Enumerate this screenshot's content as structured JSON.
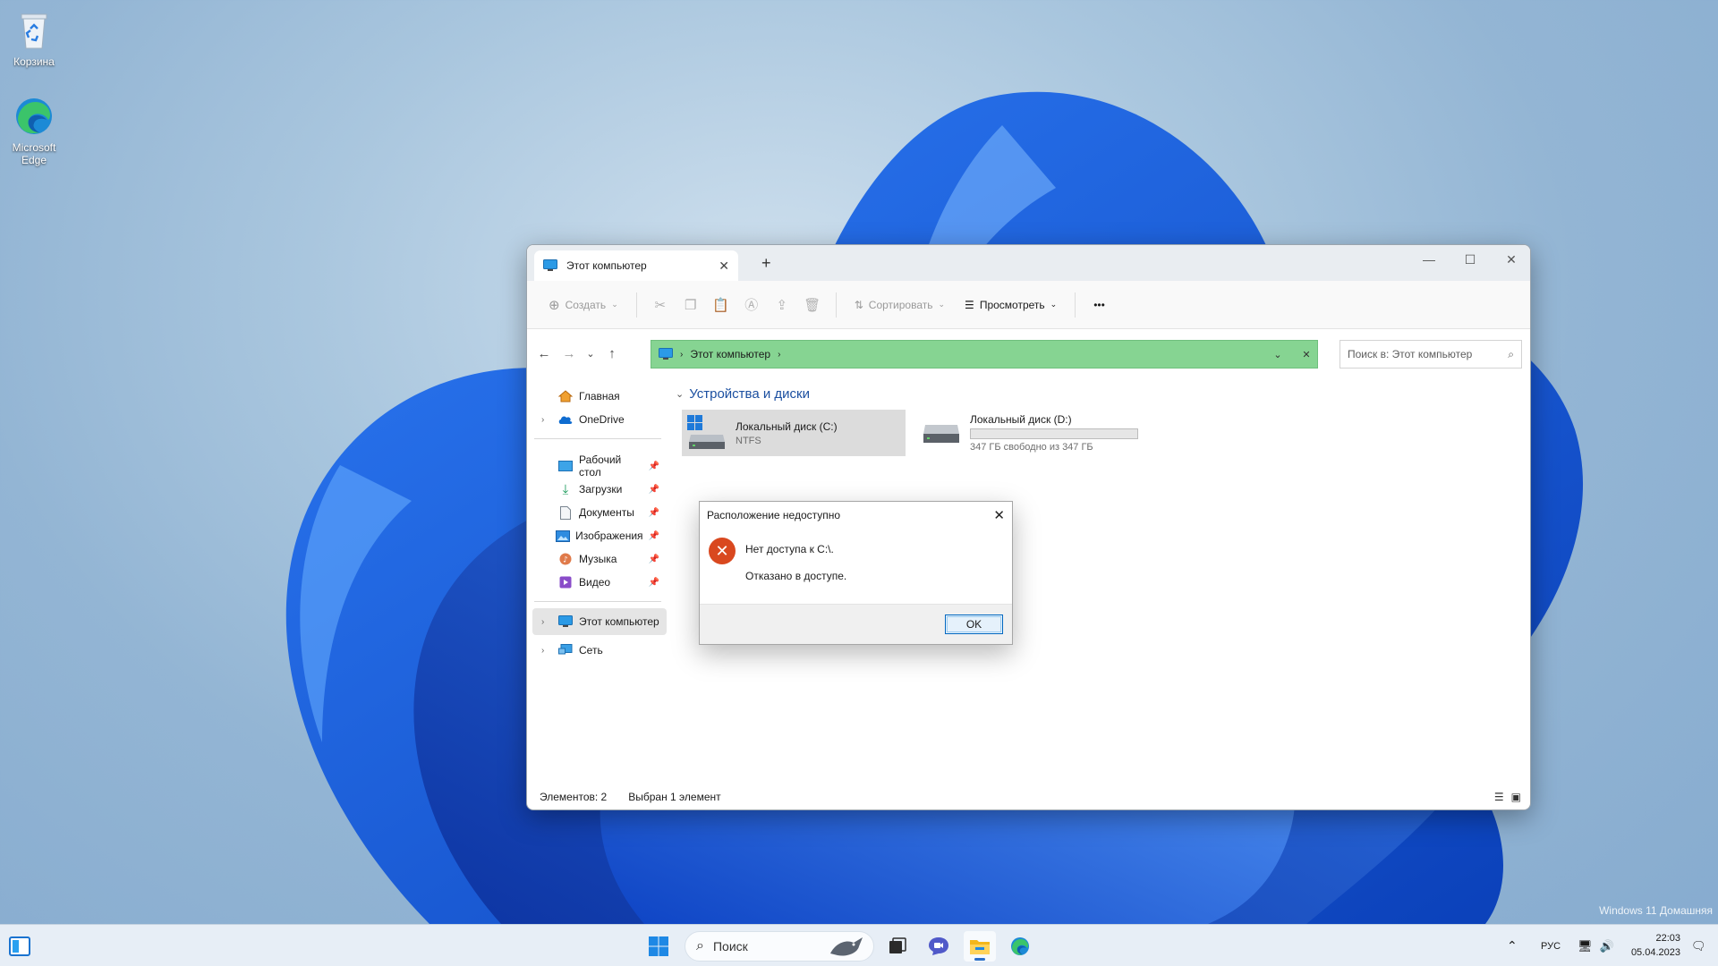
{
  "desktop": {
    "recycle_bin_label": "Корзина",
    "edge_label_line1": "Microsoft",
    "edge_label_line2": "Edge",
    "watermark": "Windows 11 Домашняя"
  },
  "explorer": {
    "tab_title": "Этот компьютер",
    "new_tab_symbol": "+",
    "toolbar": {
      "create_label": "Создать",
      "sort_label": "Сортировать",
      "view_label": "Просмотреть",
      "more_label": "•••"
    },
    "address": {
      "path": "Этот компьютер"
    },
    "search": {
      "placeholder": "Поиск в: Этот компьютер"
    },
    "sidebar": {
      "home": "Главная",
      "onedrive": "OneDrive",
      "desktop": "Рабочий стол",
      "downloads": "Загрузки",
      "documents": "Документы",
      "pictures": "Изображения",
      "music": "Музыка",
      "videos": "Видео",
      "this_pc": "Этот компьютер",
      "network": "Сеть"
    },
    "group_header": "Устройства и диски",
    "drives": [
      {
        "name": "Локальный диск (C:)",
        "sub": "NTFS"
      },
      {
        "name": "Локальный диск (D:)",
        "sub": "347 ГБ свободно из 347 ГБ",
        "used_fraction": 0.0
      }
    ],
    "status": {
      "items": "Элементов: 2",
      "selected": "Выбран 1 элемент"
    }
  },
  "dialog": {
    "title": "Расположение недоступно",
    "message": "Нет доступа к C:\\.",
    "detail": "Отказано в доступе.",
    "ok_label": "OK"
  },
  "taskbar": {
    "search_label": "Поиск",
    "language": "РУС",
    "time": "22:03",
    "date": "05.04.2023"
  },
  "colors": {
    "address_bar": "#86d492",
    "accent": "#0067c0",
    "error": "#d9481f"
  }
}
